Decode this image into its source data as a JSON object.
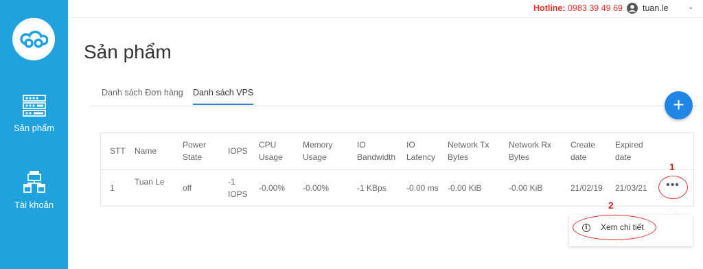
{
  "sidebar": {
    "items": [
      {
        "label": "Sản phẩm",
        "icon": "server-icon"
      },
      {
        "label": "Tài khoản",
        "icon": "store-icon"
      }
    ]
  },
  "header": {
    "hotline_label": "Hotline:",
    "hotline_number": "0983 39 49 69",
    "username": "tuan.le"
  },
  "page": {
    "title": "Sản phẩm",
    "tabs": [
      {
        "label": "Danh sách Đơn hàng",
        "active": false
      },
      {
        "label": "Danh sách VPS",
        "active": true
      }
    ],
    "add_button": "+"
  },
  "table": {
    "headers": [
      "STT",
      "Name",
      "Power State",
      "IOPS",
      "CPU Usage",
      "Memory Usage",
      "IO Bandwidth",
      "IO Latency",
      "Network Tx Bytes",
      "Network Rx Bytes",
      "Create date",
      "Expired date"
    ],
    "rows": [
      [
        "1",
        "Tuan Le",
        "off",
        "-1 IOPS",
        "-0.00%",
        "-0.00%",
        "-1 KBps",
        "-0.00 ms",
        "-0.00 KiB",
        "-0.00 KiB",
        "21/02/19",
        "21/03/21"
      ]
    ],
    "more_button": "•••"
  },
  "dropdown": {
    "items": [
      {
        "label": "Xem chi tiết",
        "icon": "info-icon"
      }
    ]
  },
  "annotations": [
    "1",
    "2"
  ],
  "colors": {
    "sidebar": "#1fa2dd",
    "accent": "#1f86e6",
    "hotline": "#e5332a",
    "annotation": "#d33333"
  }
}
